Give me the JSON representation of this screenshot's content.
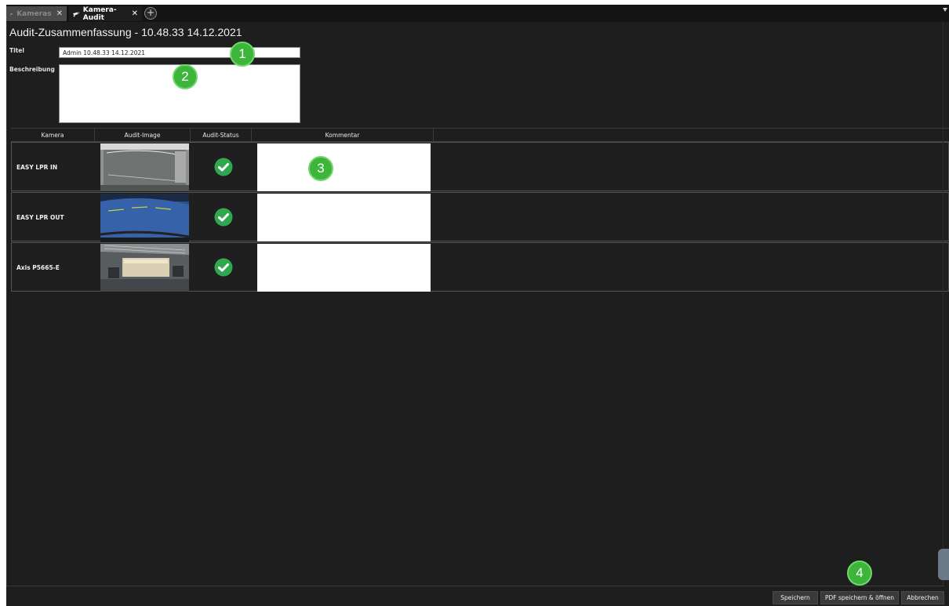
{
  "tabs": [
    {
      "label": "Kameras",
      "active": false
    },
    {
      "label": "Kamera-Audit",
      "active": true
    }
  ],
  "page_title": "Audit-Zusammenfassung - 10.48.33  14.12.2021",
  "form": {
    "titel_label": "Titel",
    "titel_value": "Admin 10.48.33  14.12.2021",
    "beschreibung_label": "Beschreibung",
    "beschreibung_value": ""
  },
  "table": {
    "columns": [
      "Kamera",
      "Audit-Image",
      "Audit-Status",
      "Kommentar"
    ],
    "rows": [
      {
        "camera": "EASY LPR IN",
        "status": "ok",
        "comment": ""
      },
      {
        "camera": "EASY LPR OUT",
        "status": "ok",
        "comment": ""
      },
      {
        "camera": "Axis P5665-E",
        "status": "ok",
        "comment": ""
      }
    ]
  },
  "badges": [
    "1",
    "2",
    "3",
    "4"
  ],
  "buttons": {
    "save": "Speichern",
    "save_pdf": "PDF speichern & öffnen",
    "cancel": "Abbrechen"
  },
  "colors": {
    "background": "#1e1e1e",
    "badge_green": "#3cb53a",
    "status_green": "#2fa84f"
  },
  "icons": {
    "camera": "camera-icon",
    "close": "close-icon",
    "add_tab": "plus-circle-icon",
    "status_ok": "check-circle-icon"
  }
}
